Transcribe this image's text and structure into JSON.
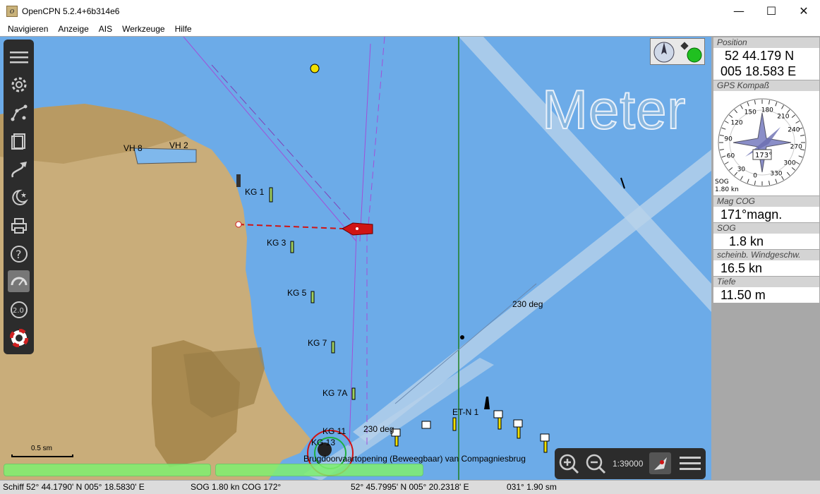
{
  "window": {
    "title": "OpenCPN 5.2.4+6b314e6",
    "minimize_glyph": "—",
    "maximize_glyph": "☐",
    "close_glyph": "✕"
  },
  "menu": [
    "Navigieren",
    "Anzeige",
    "AIS",
    "Werkzeuge",
    "Hilfe"
  ],
  "toolbar": {
    "icons": [
      "menu-icon",
      "settings-icon",
      "route-icon",
      "document-icon",
      "track-icon",
      "moon-star-icon",
      "print-icon",
      "help-icon",
      "dashboard-icon",
      "scale-icon",
      "lifebuoy-icon"
    ],
    "scale_badge": "2.0"
  },
  "chart": {
    "overlay_text": "Meter",
    "labels": {
      "vh8": "VH 8",
      "vh2": "VH 2",
      "kg1": "KG 1",
      "kg3": "KG 3",
      "kg5": "KG 5",
      "kg7": "KG 7",
      "kg7a": "KG 7A",
      "kg11": "KG 11",
      "kg13": "KG 13",
      "etn1": "ET-N 1",
      "deg230a": "230 deg",
      "deg230b": "230 deg",
      "bridge": "Brugdoorvaartopening (Beweegbaar) van Compagniesbrug"
    },
    "scalebar_label": "0.5 sm",
    "zoom_scale": "1:39000",
    "colors": {
      "water": "#6cabe8",
      "land": "#c9ad7a",
      "ship": "#d01414",
      "channel": "#a050d8"
    }
  },
  "dashboard": {
    "position": {
      "title": "Position",
      "lat": "52 44.179 N",
      "lon": "005 18.583 E"
    },
    "compass": {
      "title": "GPS Kompaß",
      "heading_value": "173°",
      "sog_label": "SOG",
      "sog_value": "1.80 kn",
      "ring_labels": [
        "180",
        "150",
        "120",
        "90",
        "60",
        "30",
        "0",
        "330",
        "300",
        "270",
        "240",
        "210"
      ]
    },
    "mag_cog": {
      "title": "Mag COG",
      "value": "171°magn."
    },
    "sog": {
      "title": "SOG",
      "value": "1.8 kn"
    },
    "wind": {
      "title": "scheinb. Windgeschw.",
      "value": "16.5 kn"
    },
    "depth": {
      "title": "Tiefe",
      "value": "11.50 m"
    }
  },
  "status": {
    "ship": "Schiff 52° 44.1790' N   005° 18.5830' E",
    "sogcog": "SOG 1.80 kn  COG 172°",
    "cursor": "52° 45.7995' N   005° 20.2318' E",
    "bearing": "031°  1.90 sm"
  }
}
